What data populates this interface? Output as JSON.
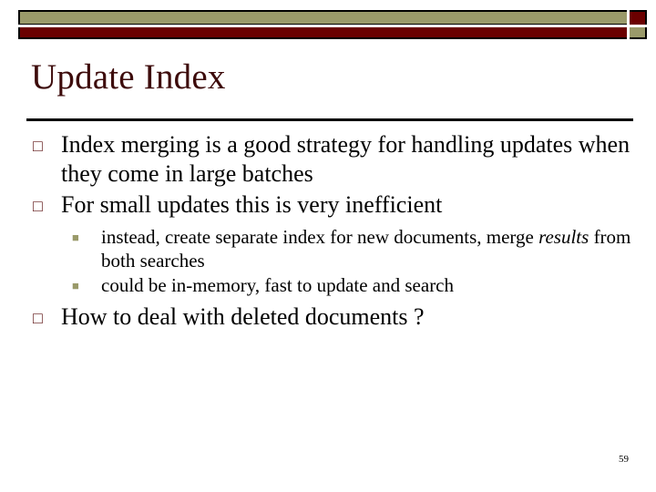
{
  "theme": {
    "olive": "#9a9a6a",
    "maroon": "#6b0000",
    "title_color": "#3d0b0b",
    "body_color": "#000000",
    "level1_marker": "□",
    "level2_marker": "■"
  },
  "slide": {
    "title": "Update Index",
    "page_number": "59",
    "bullets": [
      {
        "level": 1,
        "marker": "□",
        "text": "Index merging is a good strategy for handling updates when they come in large batches"
      },
      {
        "level": 1,
        "marker": "□",
        "text": "For small updates this is very inefficient"
      },
      {
        "level": 2,
        "marker": "■",
        "text_before_italic": "instead, create separate index for new documents, merge ",
        "italic": "results",
        "text_after_italic": " from both searches"
      },
      {
        "level": 2,
        "marker": "■",
        "text": "could be in-memory, fast to update and search"
      },
      {
        "level": 1,
        "marker": "□",
        "text": "How to deal with deleted documents ?"
      }
    ]
  }
}
